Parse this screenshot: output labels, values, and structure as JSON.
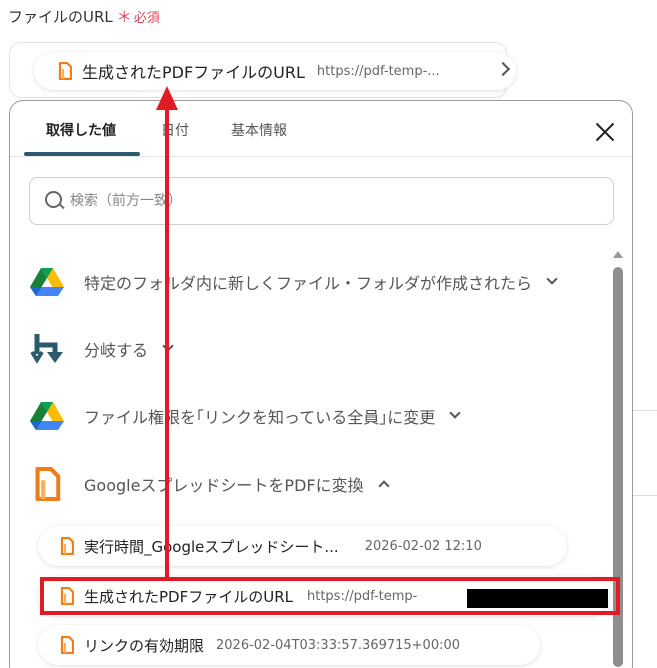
{
  "field": {
    "label": "ファイルのURL",
    "required_star": "＊",
    "required_text": "必須",
    "selected": {
      "name": "生成されたPDFファイルのURL",
      "value": "https://pdf-temp-..."
    }
  },
  "tabs": [
    "取得した値",
    "日付",
    "基本情報"
  ],
  "active_tab": "取得した値",
  "search": {
    "placeholder": "検索（前方一致）"
  },
  "steps": [
    {
      "label": "特定のフォルダ内に新しくファイル・フォルダが作成されたら",
      "icon": "google-drive-icon",
      "expanded": false
    },
    {
      "label": "分岐する",
      "icon": "branch-icon",
      "expanded": false
    },
    {
      "label": "ファイル権限を｢リンクを知っている全員｣に変更",
      "icon": "google-drive-icon",
      "expanded": false
    },
    {
      "label": "GoogleスプレッドシートをPDFに変換",
      "icon": "pdf-convert-icon",
      "expanded": true
    }
  ],
  "outputs": [
    {
      "name": "実行時間_Googleスプレッドシート...",
      "value": "2026-02-02 12:10"
    },
    {
      "name": "生成されたPDFファイルのURL",
      "value": "https://pdf-temp-"
    },
    {
      "name": "リンクの有効期限",
      "value": "2026-02-04T03:33:57.369715+00:00"
    }
  ],
  "colors": {
    "accent": "#e01b24",
    "required": "#e0445a",
    "tab_underline": "#2b5a6c",
    "doc_icon": "#f07c1a"
  }
}
